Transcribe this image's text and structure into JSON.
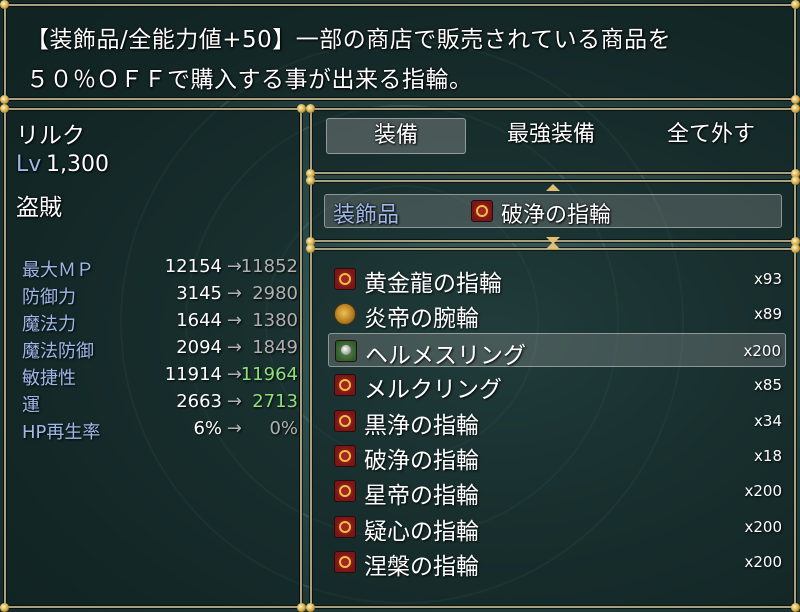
{
  "help": {
    "line1": "【装飾品/全能力値+50】一部の商店で販売されている商品を",
    "line2": "５０％ＯＦＦで購入する事が出来る指輪。"
  },
  "actor": {
    "name": "リルク",
    "level_label": "Lv",
    "level_value": "1,300",
    "class": "盗賊"
  },
  "stats": [
    {
      "label": "最大ＭＰ",
      "current": "12154",
      "arrow": "→",
      "new": "11852",
      "change": "down"
    },
    {
      "label": "防御力",
      "current": "3145",
      "arrow": "→",
      "new": "2980",
      "change": "down"
    },
    {
      "label": "魔法力",
      "current": "1644",
      "arrow": "→",
      "new": "1380",
      "change": "down"
    },
    {
      "label": "魔法防御",
      "current": "2094",
      "arrow": "→",
      "new": "1849",
      "change": "down"
    },
    {
      "label": "敏捷性",
      "current": "11914",
      "arrow": "→",
      "new": "11964",
      "change": "up"
    },
    {
      "label": "運",
      "current": "2663",
      "arrow": "→",
      "new": "2713",
      "change": "up"
    },
    {
      "label": "HP再生率",
      "current": "6%",
      "arrow": "→",
      "new": "0%",
      "change": "down"
    }
  ],
  "commands": {
    "equip": "装備",
    "optimize": "最強装備",
    "clear": "全て外す"
  },
  "slot": {
    "label": "装飾品",
    "equipped_icon": "ring-icon",
    "equipped": "破浄の指輪"
  },
  "items": [
    {
      "icon": "ring-icon",
      "name": "黄金龍の指輪",
      "count": "x93"
    },
    {
      "icon": "bracelet-icon",
      "name": "炎帝の腕輪",
      "count": "x89"
    },
    {
      "icon": "hermes-ring-icon",
      "name": "ヘルメスリング",
      "count": "x200"
    },
    {
      "icon": "ring-icon",
      "name": "メルクリング",
      "count": "x85"
    },
    {
      "icon": "ring-icon",
      "name": "黒浄の指輪",
      "count": "x34"
    },
    {
      "icon": "ring-icon",
      "name": "破浄の指輪",
      "count": "x18"
    },
    {
      "icon": "ring-icon",
      "name": "星帝の指輪",
      "count": "x200"
    },
    {
      "icon": "ring-icon",
      "name": "疑心の指輪",
      "count": "x200"
    },
    {
      "icon": "ring-icon",
      "name": "涅槃の指輪",
      "count": "x200"
    }
  ],
  "colors": {
    "system_blue": "#9fb8ea",
    "stat_up": "#8fe07a",
    "stat_down": "#b0b0b0",
    "window_border": "#a9a080"
  }
}
